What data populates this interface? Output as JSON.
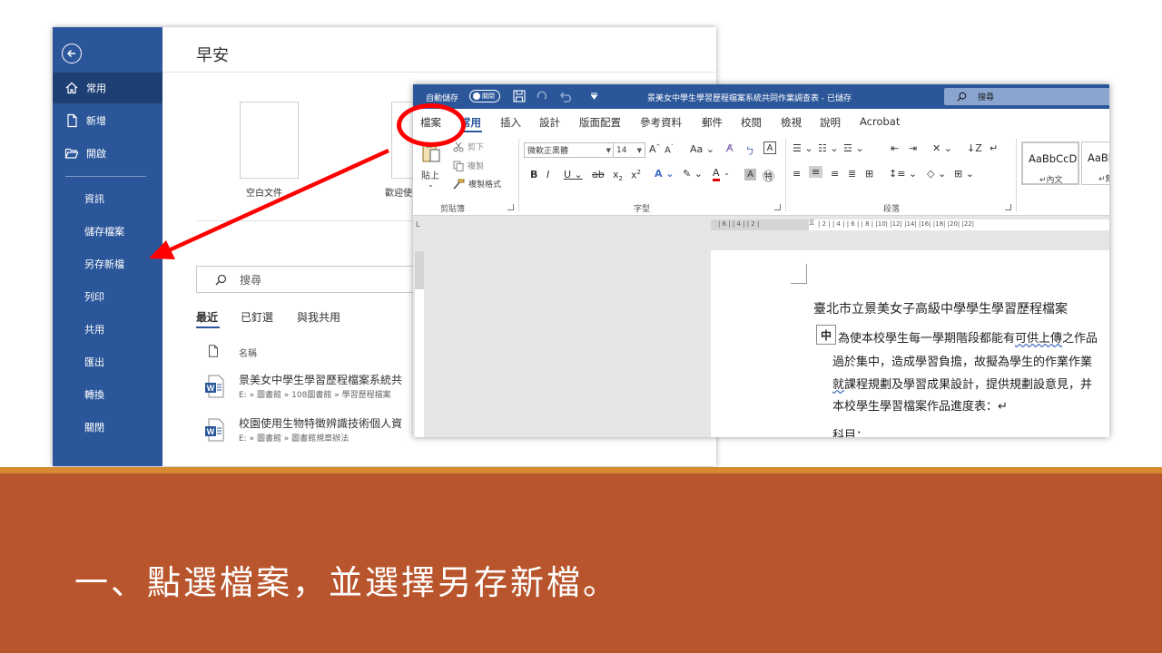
{
  "backstage": {
    "title": "早安",
    "nav": {
      "home": "常用",
      "new": "新增",
      "open": "開啟",
      "info": "資訊",
      "save": "儲存檔案",
      "save_as": "另存新檔",
      "print": "列印",
      "share": "共用",
      "export": "匯出",
      "transform": "轉換",
      "close": "關閉"
    },
    "templates": {
      "blank": "空白文件",
      "welcome": "歡迎使"
    },
    "search_placeholder": "搜尋",
    "tabs": {
      "recent": "最近",
      "pinned": "已釘選",
      "shared": "與我共用"
    },
    "column_name": "名稱",
    "files": [
      {
        "name": "景美女中學生學習歷程檔案系統共",
        "path": "E: » 圖書館 » 108圖書館 » 學習歷程檔案"
      },
      {
        "name": "校園使用生物特徵辨識技術個人資",
        "path": "E: » 圖書館 » 圖書館規章辦法"
      }
    ]
  },
  "word": {
    "titlebar": {
      "autosave": "自動儲存",
      "toggle_state": "關閉",
      "doc_title": "景美女中學生學習歷程檔案系統共同作業調查表 - 已儲存",
      "search": "搜尋"
    },
    "tabs": {
      "file": "檔案",
      "home": "常用",
      "insert": "插入",
      "design": "設計",
      "layout": "版面配置",
      "references": "參考資料",
      "mailings": "郵件",
      "review": "校閱",
      "view": "檢視",
      "help": "說明",
      "acrobat": "Acrobat"
    },
    "clipboard": {
      "paste": "貼上",
      "cut": "剪下",
      "copy": "複製",
      "format_painter": "複製格式",
      "group": "剪貼簿"
    },
    "font": {
      "name": "微軟正黑體",
      "size": "14",
      "group": "字型"
    },
    "paragraph": {
      "group": "段落"
    },
    "styles": {
      "normal_sample": "AaBbCcD",
      "normal_name": "↵內文",
      "next_sample": "AaBb",
      "next_name": "↵無"
    },
    "ruler": {
      "left_ticks": "| 6 |   | 4 |   | 2 |",
      "right_ticks": "| 2 |   | 4 |   | 6 |   | 8 |   |10|   |12|   |14|   |16|   |18|   |20|   |22|"
    },
    "document": {
      "title": "臺北市立景美女子高級中學學生學習歷程檔案",
      "char_box": "中",
      "line1_a": "為使本校學生每一學期階段都能有",
      "line1_b": "可供上傳",
      "line1_c": "之作品",
      "line2": "過於集中，造成學習負擔，故擬為學生的作業作業",
      "line3_a": "就",
      "line3_b": "課程規劃及學習成果設計，提供規劃設意見，并",
      "line4": "本校學生學習檔案作品進度表：↵",
      "line5": "科目："
    }
  },
  "caption": "一、點選檔案，並選擇另存新檔。",
  "colors": {
    "word_blue": "#2b579a",
    "band": "#b9552c",
    "band_line": "#d88a33",
    "annotation_red": "#ff0000"
  }
}
